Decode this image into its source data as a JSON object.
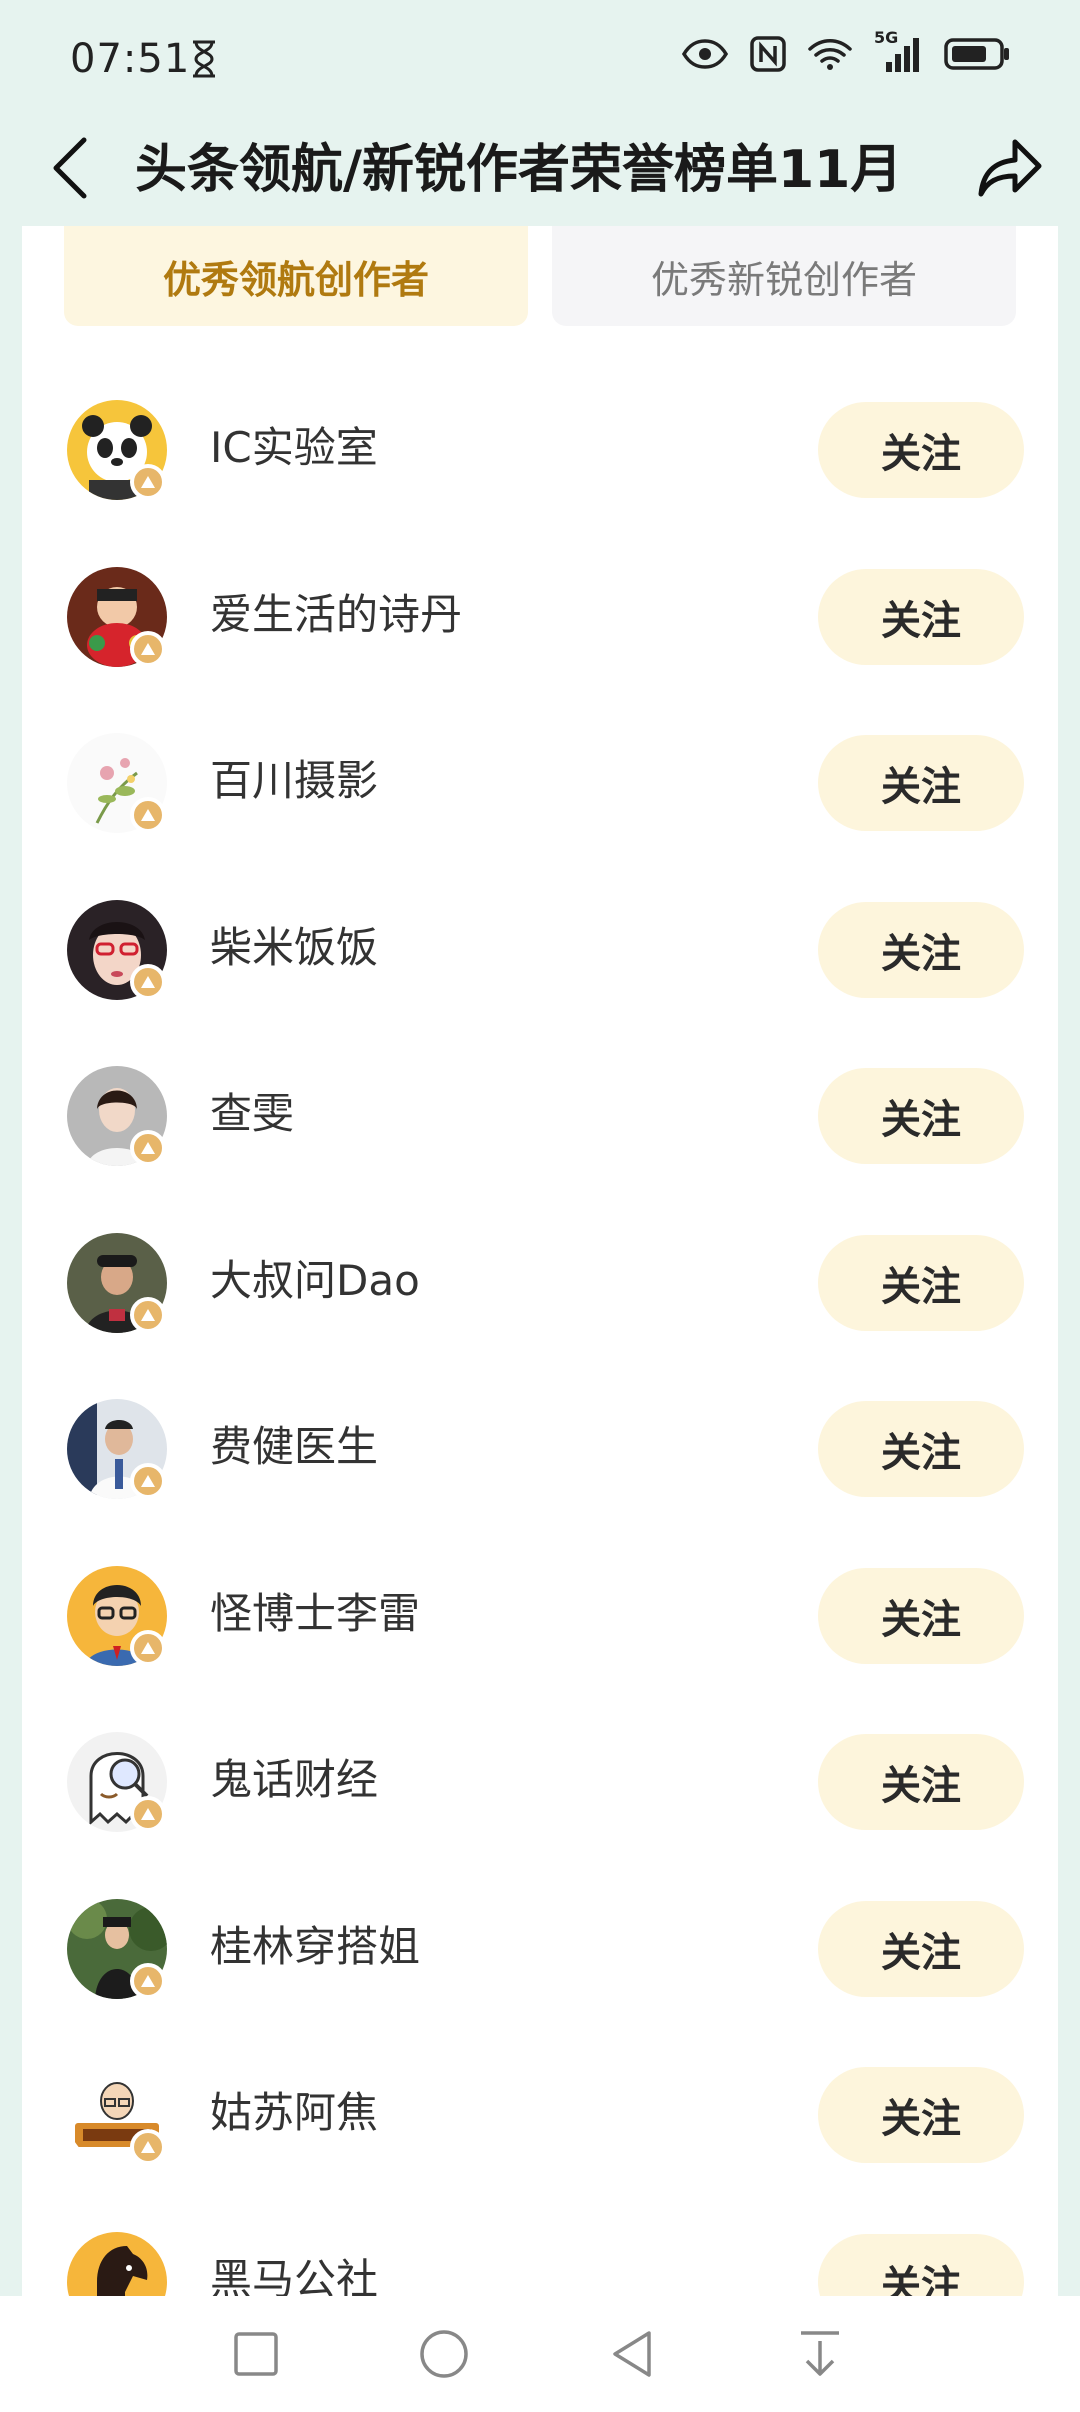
{
  "status_bar": {
    "time": "07:51",
    "icons": [
      "hourglass-icon",
      "eye-icon",
      "nfc-icon",
      "wifi-icon",
      "5g-signal-icon",
      "battery-icon"
    ],
    "network_label": "5G"
  },
  "header": {
    "title": "头条领航/新锐作者荣誉榜单11月",
    "back_icon": "chevron-left-icon",
    "share_icon": "share-icon"
  },
  "tabs": [
    {
      "label": "优秀领航创作者",
      "active": true
    },
    {
      "label": "优秀新锐创作者",
      "active": false
    }
  ],
  "authors": [
    {
      "name": "IC实验室",
      "follow_label": "关注",
      "avatar": "panda-avatar"
    },
    {
      "name": "爱生活的诗丹",
      "follow_label": "关注",
      "avatar": "doll-avatar"
    },
    {
      "name": "百川摄影",
      "follow_label": "关注",
      "avatar": "flower-avatar"
    },
    {
      "name": "柴米饭饭",
      "follow_label": "关注",
      "avatar": "woman-glasses-avatar"
    },
    {
      "name": "查雯",
      "follow_label": "关注",
      "avatar": "woman-avatar"
    },
    {
      "name": "大叔问Dao",
      "follow_label": "关注",
      "avatar": "man-cap-avatar"
    },
    {
      "name": "费健医生",
      "follow_label": "关注",
      "avatar": "doctor-avatar"
    },
    {
      "name": "怪博士李雷",
      "follow_label": "关注",
      "avatar": "cartoon-man-avatar"
    },
    {
      "name": "鬼话财经",
      "follow_label": "关注",
      "avatar": "ghost-avatar"
    },
    {
      "name": "桂林穿搭姐",
      "follow_label": "关注",
      "avatar": "woman-outdoor-avatar"
    },
    {
      "name": "姑苏阿焦",
      "follow_label": "关注",
      "avatar": "cartoon-sign-avatar"
    },
    {
      "name": "黑马公社",
      "follow_label": "关注",
      "avatar": "black-horse-avatar"
    }
  ],
  "nav_bar": [
    "recent-apps-icon",
    "home-icon",
    "back-icon",
    "notification-pull-icon"
  ],
  "colors": {
    "background": "#e6f3ef",
    "active_tab_bg": "#fdf6e0",
    "active_tab_text": "#b07a10",
    "follow_button_bg": "#fdf5dc",
    "badge": "#e7b66a"
  }
}
